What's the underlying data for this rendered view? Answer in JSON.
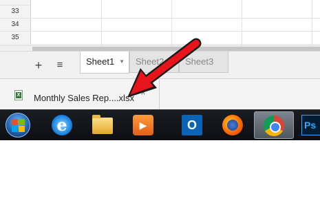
{
  "grid": {
    "row_numbers": [
      "33",
      "34",
      "35"
    ]
  },
  "sheet_tabs": {
    "add_label": "+",
    "all_sheets_label": "≡",
    "tabs": [
      {
        "label": "Sheet1",
        "caret": "▼"
      },
      {
        "label": "Sheet2"
      },
      {
        "label": "Sheet3"
      }
    ]
  },
  "download_bar": {
    "file_name": "Monthly Sales Rep....xlsx",
    "file_icon_letter": "X",
    "caret": "^"
  },
  "taskbar": {
    "items": [
      {
        "name": "start-button"
      },
      {
        "name": "internet-explorer",
        "glyph": "e"
      },
      {
        "name": "file-explorer"
      },
      {
        "name": "media-player",
        "glyph": "▶"
      },
      {
        "name": "outlook",
        "glyph": "O"
      },
      {
        "name": "firefox"
      },
      {
        "name": "chrome"
      },
      {
        "name": "photoshop",
        "glyph": "Ps"
      }
    ]
  },
  "colors": {
    "arrow": "#e8141b",
    "taskbar": "#0c0e12"
  }
}
